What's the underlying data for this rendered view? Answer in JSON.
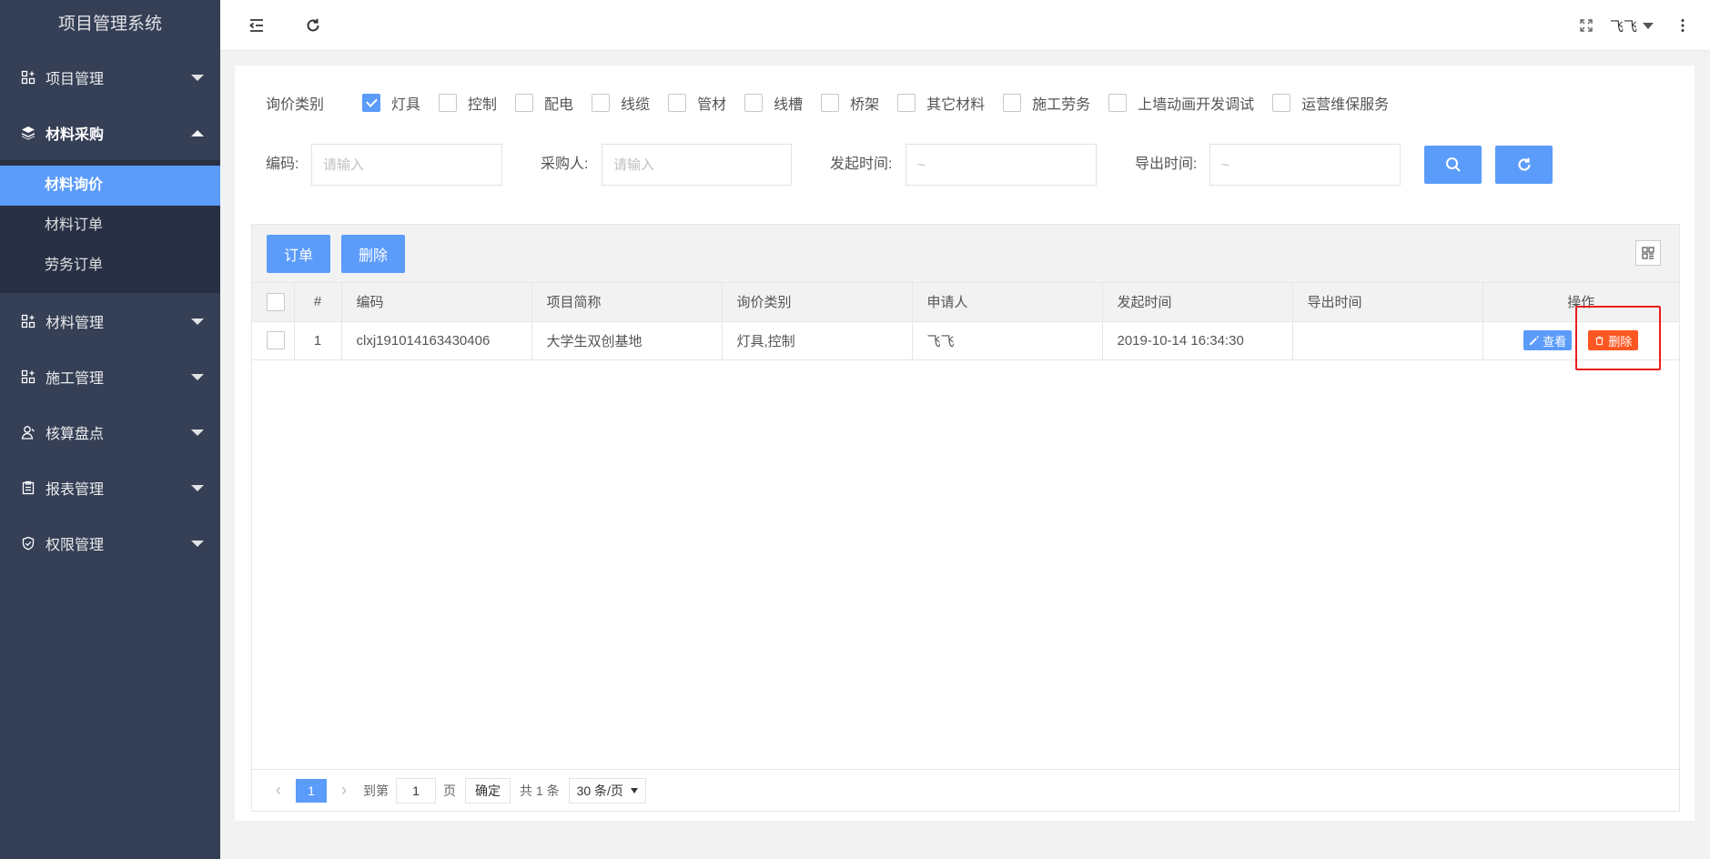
{
  "sidebar": {
    "title": "项目管理系统",
    "items": [
      {
        "label": "项目管理"
      },
      {
        "label": "材料采购"
      },
      {
        "label": "材料管理"
      },
      {
        "label": "施工管理"
      },
      {
        "label": "核算盘点"
      },
      {
        "label": "报表管理"
      },
      {
        "label": "权限管理"
      }
    ],
    "sub_items": [
      {
        "label": "材料询价"
      },
      {
        "label": "材料订单"
      },
      {
        "label": "劳务订单"
      }
    ]
  },
  "header": {
    "user": "飞飞"
  },
  "filter": {
    "label": "询价类别",
    "options": [
      {
        "label": "灯具",
        "checked": true
      },
      {
        "label": "控制",
        "checked": false
      },
      {
        "label": "配电",
        "checked": false
      },
      {
        "label": "线缆",
        "checked": false
      },
      {
        "label": "管材",
        "checked": false
      },
      {
        "label": "线槽",
        "checked": false
      },
      {
        "label": "桥架",
        "checked": false
      },
      {
        "label": "其它材料",
        "checked": false
      },
      {
        "label": "施工劳务",
        "checked": false
      },
      {
        "label": "上墙动画开发调试",
        "checked": false
      },
      {
        "label": "运营维保服务",
        "checked": false
      }
    ]
  },
  "search": {
    "code_label": "编码:",
    "code_placeholder": "请输入",
    "buyer_label": "采购人:",
    "buyer_placeholder": "请输入",
    "start_label": "发起时间:",
    "start_placeholder": "~",
    "export_label": "导出时间:",
    "export_placeholder": "~"
  },
  "toolbar": {
    "order_label": "订单",
    "delete_label": "删除"
  },
  "table": {
    "headers": [
      "#",
      "编码",
      "项目简称",
      "询价类别",
      "申请人",
      "发起时间",
      "导出时间",
      "操作"
    ],
    "rows": [
      {
        "index": "1",
        "code": "clxj191014163430406",
        "project": "大学生双创基地",
        "category": "灯具,控制",
        "applicant": "飞飞",
        "start_time": "2019-10-14 16:34:30",
        "export_time": "",
        "view_label": "查看",
        "delete_label": "删除"
      }
    ]
  },
  "pager": {
    "current": "1",
    "goto_label": "到第",
    "goto_value": "1",
    "page_unit": "页",
    "confirm_label": "确定",
    "total_label": "共 1 条",
    "page_size": "30 条/页"
  },
  "colors": {
    "sidebar_bg": "#353f55",
    "accent": "#5b9bfa",
    "danger": "#ff5722",
    "highlight": "#e81d1d"
  }
}
